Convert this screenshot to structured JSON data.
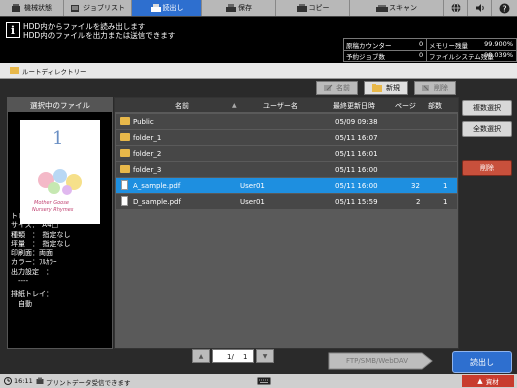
{
  "tabs": [
    {
      "label": "機械状態"
    },
    {
      "label": "ジョブリスト"
    },
    {
      "label": "読出し"
    },
    {
      "label": "保存"
    },
    {
      "label": "コピー"
    },
    {
      "label": "スキャン"
    }
  ],
  "message": {
    "line1": "HDD内からファイルを読み出します",
    "line2": "HDD内のファイルを出力または送信できます"
  },
  "status": {
    "original_count_label": "原稿カウンター",
    "original_count": "0",
    "reserved_jobs_label": "予約ジョブ数",
    "reserved_jobs": "0",
    "memory_label": "メモリー残量",
    "memory_value": "99.900%",
    "fs_label": "ファイルシステム残量",
    "fs_value": "98.039%"
  },
  "path": {
    "label": "ルートディレクトリー"
  },
  "toolbar": {
    "rename_label": "名前",
    "new_label": "新規",
    "delete_label": "削除"
  },
  "left_panel": {
    "title": "選択中のファイル",
    "thumb_number": "1",
    "thumb_text1": "Mother Goose",
    "thumb_text2": "Nursery Rhymes",
    "info": [
      "トレイ：自動",
      "サイズ：　A4□",
      "種類　：　指定なし",
      "坪量　：　指定なし",
      "印刷面：両面",
      "カラー：ﾌﾙｶﾗｰ",
      "出力設定　：",
      "　----",
      "排紙トレイ：",
      "　自動"
    ]
  },
  "table": {
    "headers": {
      "name": "名前",
      "user": "ユーザー名",
      "date": "最終更新日時",
      "pages": "ページ",
      "copies": "部数"
    },
    "rows": [
      {
        "type": "folder",
        "name": "Public",
        "user": "",
        "date": "05/09 09:38",
        "pages": "",
        "copies": ""
      },
      {
        "type": "folder",
        "name": "folder_1",
        "user": "",
        "date": "05/11 16:07",
        "pages": "",
        "copies": ""
      },
      {
        "type": "folder",
        "name": "folder_2",
        "user": "",
        "date": "05/11 16:01",
        "pages": "",
        "copies": ""
      },
      {
        "type": "folder",
        "name": "folder_3",
        "user": "",
        "date": "05/11 16:00",
        "pages": "",
        "copies": ""
      },
      {
        "type": "file",
        "name": "A_sample.pdf",
        "user": "User01",
        "date": "05/11 16:00",
        "pages": "32",
        "copies": "1",
        "selected": true
      },
      {
        "type": "file",
        "name": "D_sample.pdf",
        "user": "User01",
        "date": "05/11 15:59",
        "pages": "2",
        "copies": "1"
      }
    ]
  },
  "side_buttons": {
    "multi_select": "複数選択",
    "select_all": "全数選択",
    "delete": "削除"
  },
  "pager": {
    "current": "1/",
    "total": "1"
  },
  "ftp_label": "FTP/SMB/WebDAV",
  "read_button": "読出し",
  "bottom": {
    "time": "16:11",
    "message": "プリントデータ受信できます",
    "material": "資材"
  }
}
